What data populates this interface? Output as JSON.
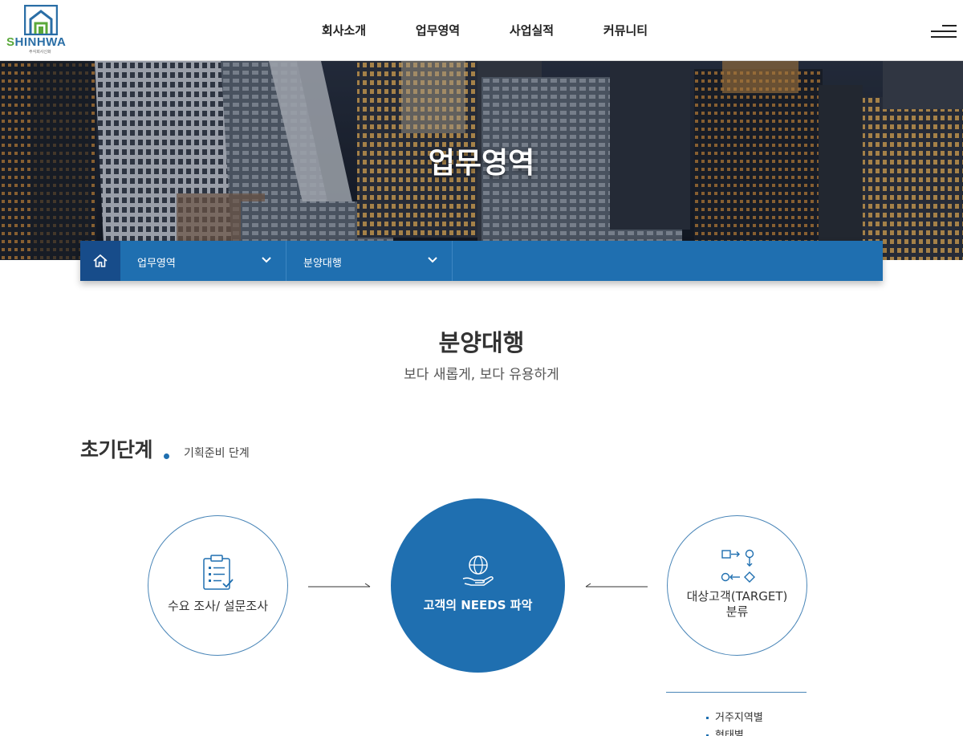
{
  "header": {
    "logo_text_first": "S",
    "logo_text_rest": "HINHWA",
    "logo_subtext": "주식회사신화",
    "nav": [
      "회사소개",
      "업무영역",
      "사업실적",
      "커뮤니티"
    ],
    "menu_icon": "hamburger-icon"
  },
  "hero": {
    "title": "업무영역"
  },
  "breadcrumb": {
    "home_icon": "home-icon",
    "items": [
      {
        "label": "업무영역",
        "icon": "chevron-down-icon"
      },
      {
        "label": "분양대행",
        "icon": "chevron-down-icon"
      }
    ]
  },
  "section": {
    "title": "분양대행",
    "subtitle": "보다 새롭게, 보다 유용하게"
  },
  "stage": {
    "title": "초기단계",
    "subtitle": "기획준비 단계"
  },
  "flow": [
    {
      "label": "수요 조사/ 설문조사",
      "icon": "clipboard-checklist-icon"
    },
    {
      "label": "고객의 NEEDS 파악",
      "icon": "globe-hand-icon"
    },
    {
      "label_line1": "대상고객(TARGET)",
      "label_line2": "분류",
      "icon": "flow-shapes-icon"
    }
  ],
  "target_list": [
    "거주지역별",
    "형태별"
  ],
  "colors": {
    "primary": "#1f6fb0",
    "primary_dark": "#174c8a",
    "logo_green": "#5aa83a"
  }
}
